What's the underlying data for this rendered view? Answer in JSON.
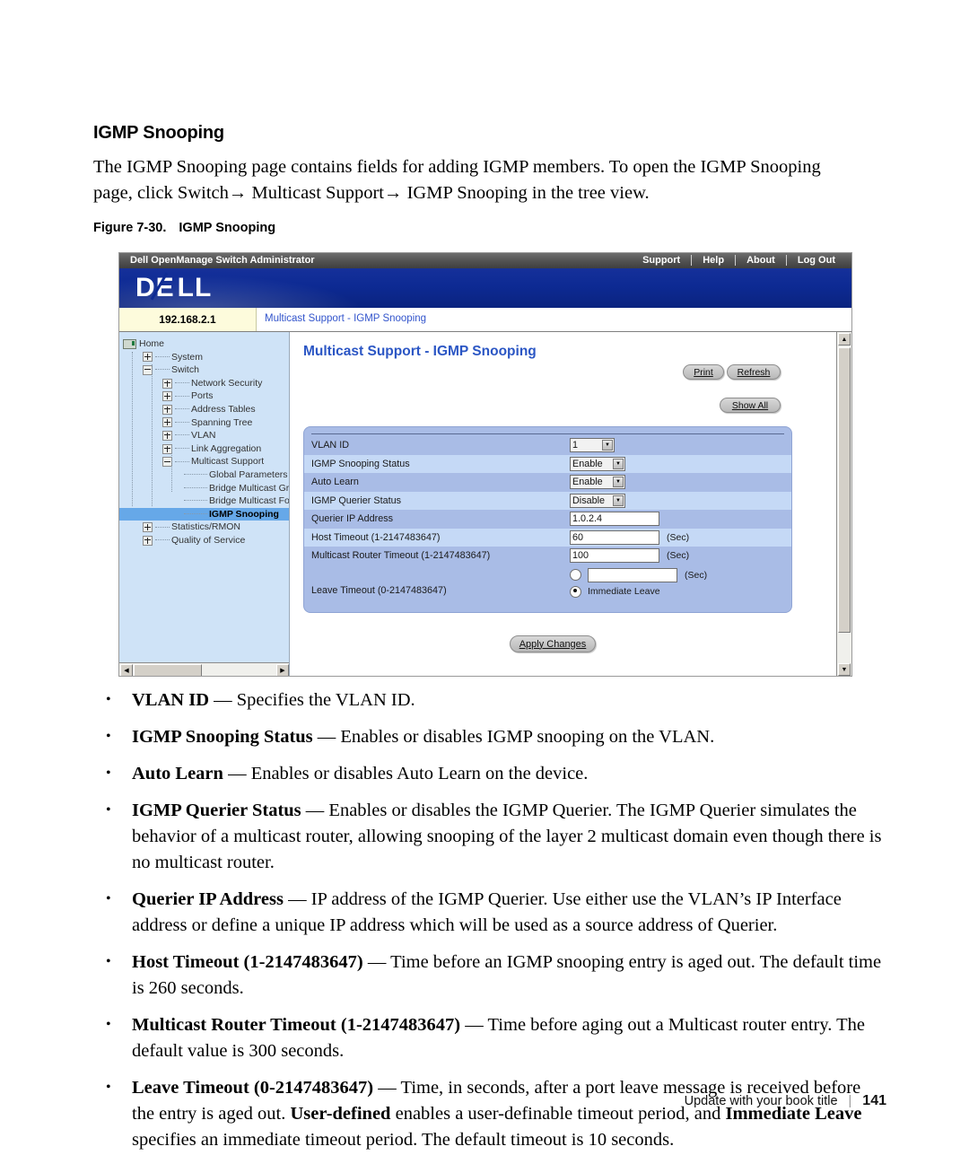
{
  "document": {
    "heading": "IGMP Snooping",
    "intro": "The IGMP Snooping page contains fields for adding IGMP members. To open the IGMP Snooping page, click Switch→ Multicast Support→ IGMP Snooping in the tree view.",
    "figure_number": "Figure 7-30.",
    "figure_title": "IGMP Snooping"
  },
  "screenshot": {
    "titlebar": {
      "app_title": "Dell OpenManage Switch Administrator",
      "links": [
        "Support",
        "Help",
        "About",
        "Log Out"
      ]
    },
    "banner": {
      "logo_text_1": "D",
      "logo_text_2": "E",
      "logo_text_3": "LL"
    },
    "ip_row": {
      "ip_address": "192.168.2.1",
      "breadcrumb": "Multicast Support - IGMP Snooping"
    },
    "tree": {
      "items": [
        {
          "label": "Home",
          "indent": 0,
          "toggle": "none",
          "icon": "folder",
          "selected": false
        },
        {
          "label": "System",
          "indent": 1,
          "toggle": "plus",
          "icon": "none",
          "selected": false
        },
        {
          "label": "Switch",
          "indent": 1,
          "toggle": "minus",
          "icon": "none",
          "selected": false
        },
        {
          "label": "Network Security",
          "indent": 2,
          "toggle": "plus",
          "icon": "none",
          "selected": false
        },
        {
          "label": "Ports",
          "indent": 2,
          "toggle": "plus",
          "icon": "none",
          "selected": false
        },
        {
          "label": "Address Tables",
          "indent": 2,
          "toggle": "plus",
          "icon": "none",
          "selected": false
        },
        {
          "label": "Spanning Tree",
          "indent": 2,
          "toggle": "plus",
          "icon": "none",
          "selected": false
        },
        {
          "label": "VLAN",
          "indent": 2,
          "toggle": "plus",
          "icon": "none",
          "selected": false
        },
        {
          "label": "Link Aggregation",
          "indent": 2,
          "toggle": "plus",
          "icon": "none",
          "selected": false
        },
        {
          "label": "Multicast Support",
          "indent": 2,
          "toggle": "minus",
          "icon": "none",
          "selected": false
        },
        {
          "label": "Global Parameters",
          "indent": 3,
          "toggle": "none",
          "icon": "none",
          "selected": false
        },
        {
          "label": "Bridge Multicast Gr",
          "indent": 3,
          "toggle": "none",
          "icon": "none",
          "selected": false
        },
        {
          "label": "Bridge Multicast Fo",
          "indent": 3,
          "toggle": "none",
          "icon": "none",
          "selected": false
        },
        {
          "label": "IGMP Snooping",
          "indent": 3,
          "toggle": "none",
          "icon": "none",
          "selected": true
        },
        {
          "label": "Statistics/RMON",
          "indent": 1,
          "toggle": "plus",
          "icon": "none",
          "selected": false
        },
        {
          "label": "Quality of Service",
          "indent": 1,
          "toggle": "plus",
          "icon": "none",
          "selected": false
        }
      ]
    },
    "content": {
      "page_title": "Multicast Support - IGMP Snooping",
      "buttons": {
        "print": "Print",
        "refresh": "Refresh",
        "show_all": "Show All",
        "apply_changes": "Apply Changes"
      },
      "form": {
        "rows": [
          {
            "label": "VLAN ID",
            "control": "select",
            "value": "1",
            "unit": ""
          },
          {
            "label": "IGMP Snooping Status",
            "control": "select",
            "value": "Enable",
            "unit": ""
          },
          {
            "label": "Auto Learn",
            "control": "select",
            "value": "Enable",
            "unit": ""
          },
          {
            "label": "IGMP Querier Status",
            "control": "select",
            "value": "Disable",
            "unit": ""
          },
          {
            "label": "Querier IP Address",
            "control": "text",
            "value": "1.0.2.4",
            "unit": ""
          },
          {
            "label": "Host Timeout (1-2147483647)",
            "control": "text",
            "value": "60",
            "unit": "(Sec)"
          },
          {
            "label": "Multicast Router Timeout (1-2147483647)",
            "control": "text",
            "value": "100",
            "unit": "(Sec)"
          }
        ],
        "leave_timeout": {
          "label": "Leave Timeout (0-2147483647)",
          "user_defined_value": "",
          "unit": "(Sec)",
          "user_defined_selected": false,
          "immediate_leave_label": "Immediate Leave",
          "immediate_leave_selected": true
        }
      }
    }
  },
  "bullets": [
    {
      "term": "VLAN ID",
      "desc": " — Specifies the VLAN ID."
    },
    {
      "term": "IGMP Snooping Status",
      "desc": " — Enables or disables IGMP snooping on the VLAN."
    },
    {
      "term": "Auto Learn",
      "desc": " — Enables or disables Auto Learn on the device."
    },
    {
      "term": "IGMP Querier Status",
      "desc": " — Enables or disables the IGMP Querier. The IGMP Querier simulates the behavior of a multicast router, allowing snooping of the layer 2 multicast domain even though there is no multicast router."
    },
    {
      "term": "Querier IP Address",
      "desc": " — IP address of the IGMP Querier. Use either use the VLAN’s IP Interface address or define a unique IP address which will be used as a source address of Querier."
    },
    {
      "term": "Host Timeout (1-2147483647)",
      "desc": " — Time before an IGMP snooping entry is aged out. The default time is 260 seconds."
    },
    {
      "term": "Multicast Router Timeout (1-2147483647)",
      "desc": " — Time before aging out a Multicast router entry. The default value is 300 seconds."
    },
    {
      "term": "Leave Timeout (0-2147483647)",
      "desc": " — Time, in seconds, after a port leave message is received before the entry is aged out. ",
      "term2": "User-defined",
      "desc2": " enables a user-definable timeout period, and ",
      "term3": "Immediate Leave",
      "desc3": " specifies an immediate timeout period. The default timeout is 10 seconds."
    }
  ],
  "footer": {
    "book_title": "Update with your book title",
    "separator": "|",
    "page_number": "141"
  },
  "colors": {
    "banner_blue": "#0d2a93",
    "title_blue": "#2b56c4",
    "tree_bg": "#cfe3f7",
    "tree_selected": "#66a8e8",
    "form_bg": "#a9bce6",
    "form_alt": "#c5d9f6",
    "ip_tab": "#fdfbdc"
  }
}
